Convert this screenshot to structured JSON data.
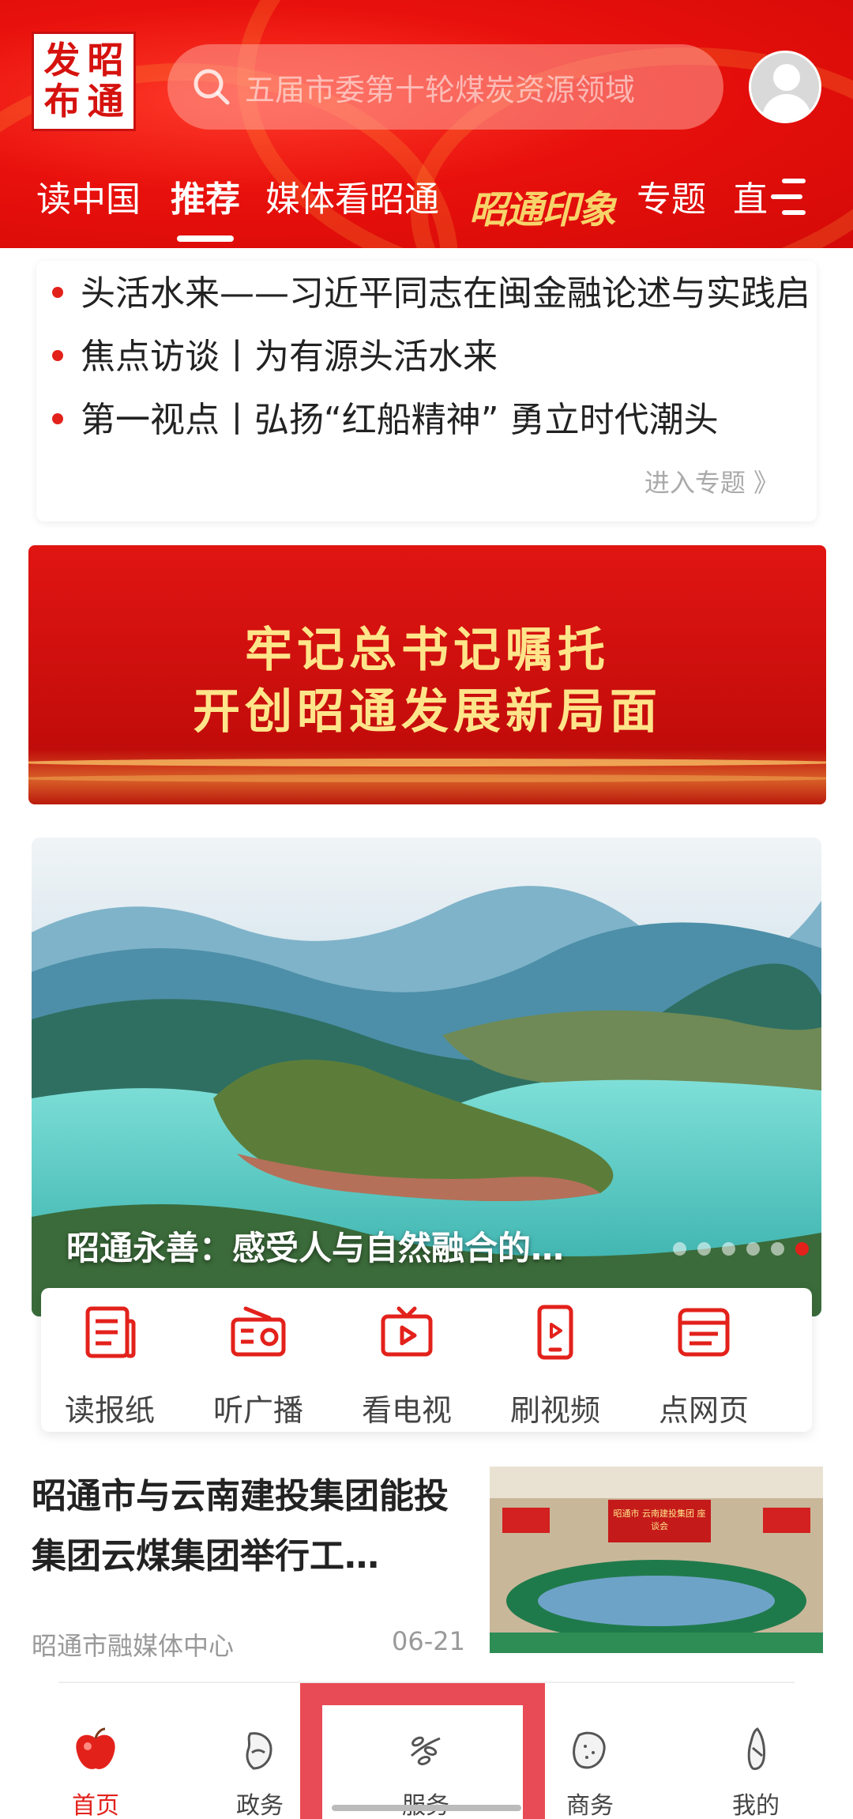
{
  "header": {
    "logo_chars": [
      "发",
      "昭",
      "布",
      "通"
    ],
    "search_placeholder": "五届市委第十轮煤炭资源领域",
    "tabs": [
      {
        "label": "读中国"
      },
      {
        "label": "推荐",
        "active": true
      },
      {
        "label": "媒体看昭通"
      },
      {
        "label": "昭通印象"
      },
      {
        "label": "专题"
      },
      {
        "label": "直"
      }
    ],
    "colors": {
      "brand_red": "#e3211b",
      "tab_gold": "#f7d46a"
    }
  },
  "topic": {
    "lines": [
      "头活水来——习近平同志在闽金融论述与实践启",
      "焦点访谈丨为有源头活水来",
      "第一视点丨弘扬“红船精神” 勇立时代潮头"
    ],
    "more_label": "进入专题 》"
  },
  "banner": {
    "line1": "牢记总书记嘱托",
    "line2": "开创昭通发展新局面"
  },
  "hero": {
    "caption": "昭通永善：感受人与自然融合的…",
    "page_count": 6,
    "active_page": 6
  },
  "shortcuts": [
    {
      "label": "读报纸",
      "icon": "newspaper-icon"
    },
    {
      "label": "听广播",
      "icon": "radio-icon"
    },
    {
      "label": "看电视",
      "icon": "tv-icon"
    },
    {
      "label": "刷视频",
      "icon": "phone-video-icon"
    },
    {
      "label": "点网页",
      "icon": "webpage-icon"
    }
  ],
  "news": {
    "title": "昭通市与云南建投集团能投集团云煤集团举行工…",
    "source": "昭通市融媒体中心",
    "date": "06-21",
    "thumb_banner": "昭通市 云南建投集团 座谈会"
  },
  "bottom_nav": [
    {
      "label": "首页",
      "icon": "home-apple-icon",
      "active": true
    },
    {
      "label": "政务",
      "icon": "government-icon"
    },
    {
      "label": "服务",
      "icon": "service-icon"
    },
    {
      "label": "商务",
      "icon": "business-icon"
    },
    {
      "label": "我的",
      "icon": "profile-icon"
    }
  ]
}
